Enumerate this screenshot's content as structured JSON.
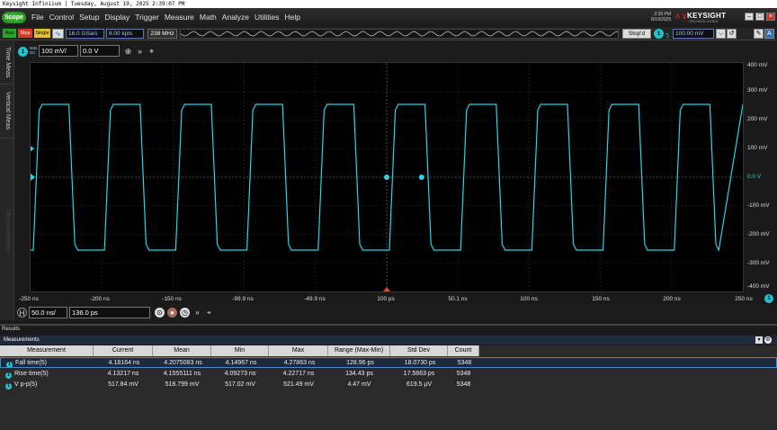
{
  "window": {
    "title": "Keysight Infiniium | Tuesday, August 19, 2025 2:39:07 PM"
  },
  "menu": {
    "logo": "Scope",
    "items": [
      "File",
      "Control",
      "Setup",
      "Display",
      "Trigger",
      "Measure",
      "Math",
      "Analyze",
      "Utilities",
      "Help"
    ],
    "clock_time": "2:39 PM",
    "clock_date": "8/19/2025",
    "brand": "KEYSIGHT",
    "brand_sub": "TECHNOLOGIES"
  },
  "toolbar": {
    "run_label": "Run",
    "stop_label": "Stop",
    "single_label": "Single",
    "sample_rate": "16.0 GSa/s",
    "memory_depth": "8.00 kpts",
    "bandwidth": "238 MHz",
    "acq_status": "Stop'd",
    "trigger_channel": "1",
    "trigger_level": "100.00 mV"
  },
  "side_tabs": [
    "Time Meas",
    "Vertical Meas",
    "Measurements"
  ],
  "channel": {
    "number": "1",
    "coupling_top": "50Ω",
    "coupling_bottom": "DC",
    "scale": "100 mV/",
    "offset": "0.0 V"
  },
  "axes": {
    "y_labels": [
      "400 mV",
      "300 mV",
      "200 mV",
      "100 mV",
      "0.0 V",
      "-100 mV",
      "-200 mV",
      "-300 mV",
      "-400 mV"
    ],
    "x_labels": [
      "-250 ns",
      "-200 ns",
      "-150 ns",
      "-99.9 ns",
      "-49.9 ns",
      "100 ps",
      "50.1 ns",
      "100 ns",
      "150 ns",
      "200 ns",
      "250 ns"
    ]
  },
  "waveform": {
    "color": "#2ad4e4",
    "period_ns": 50,
    "high_mV": 255,
    "low_mV": -255,
    "duty": 0.5,
    "x_range_ns": [
      -250,
      250
    ],
    "y_range_mV": [
      -400,
      400
    ]
  },
  "timebase": {
    "scale": "50.0 ns/",
    "position": "136.0 ps"
  },
  "results": {
    "panel_title": "Results",
    "tab_title": "Measurements",
    "columns": [
      "Measurement",
      "Current",
      "Mean",
      "Min",
      "Max",
      "Range (Max-Min)",
      "Std Dev",
      "Count"
    ],
    "rows": [
      {
        "channel": "1",
        "name": "Fall time(5)",
        "current": "4.18164 ns",
        "mean": "4.2075083 ns",
        "min": "4.14967 ns",
        "max": "4.27863 ns",
        "range": "128.96 ps",
        "std": "18.0730 ps",
        "count": "5348"
      },
      {
        "channel": "1",
        "name": "Rise time(5)",
        "current": "4.13217 ns",
        "mean": "4.1555111 ns",
        "min": "4.09273 ns",
        "max": "4.22717 ns",
        "range": "134.43 ps",
        "std": "17.5863 ps",
        "count": "5348"
      },
      {
        "channel": "1",
        "name": "V p-p(5)",
        "current": "517.84 mV",
        "mean": "518.799 mV",
        "min": "517.02 mV",
        "max": "521.49 mV",
        "range": "4.47 mV",
        "std": "619.5 µV",
        "count": "5348"
      }
    ]
  }
}
